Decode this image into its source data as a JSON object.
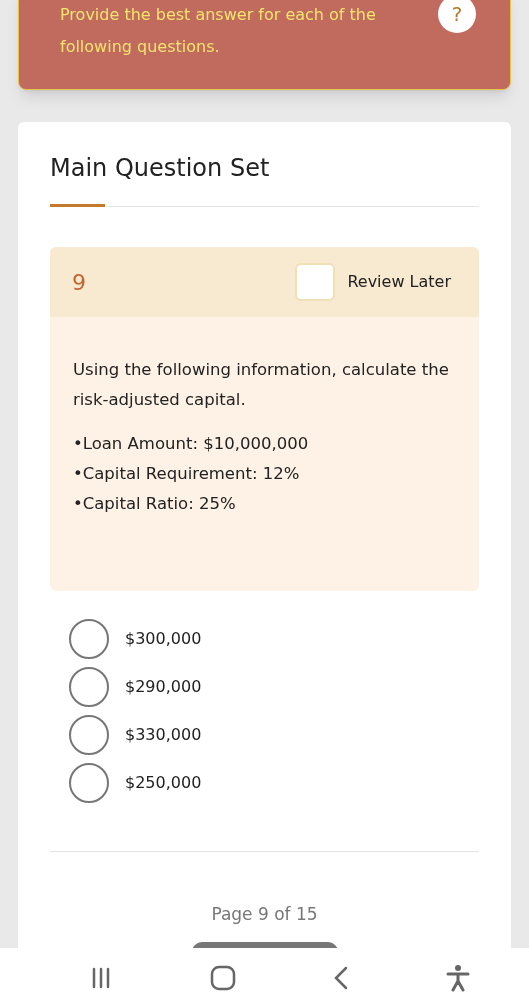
{
  "instructions": {
    "text": "Provide the best answer for each of the following questions.",
    "help": "?"
  },
  "section": {
    "title": "Main Question Set"
  },
  "question": {
    "number": "9",
    "review_later": {
      "label": "Review Later",
      "checked": false
    },
    "prompt": "Using the following information, calculate the risk-adjusted capital.",
    "facts": [
      "•Loan Amount: $10,000,000",
      "•Capital Requirement: 12%",
      "•Capital Ratio: 25%"
    ]
  },
  "options": [
    {
      "label": "$300,000",
      "selected": false
    },
    {
      "label": "$290,000",
      "selected": false
    },
    {
      "label": "$330,000",
      "selected": false
    },
    {
      "label": "$250,000",
      "selected": false
    }
  ],
  "pagination": "Page 9 of 15"
}
